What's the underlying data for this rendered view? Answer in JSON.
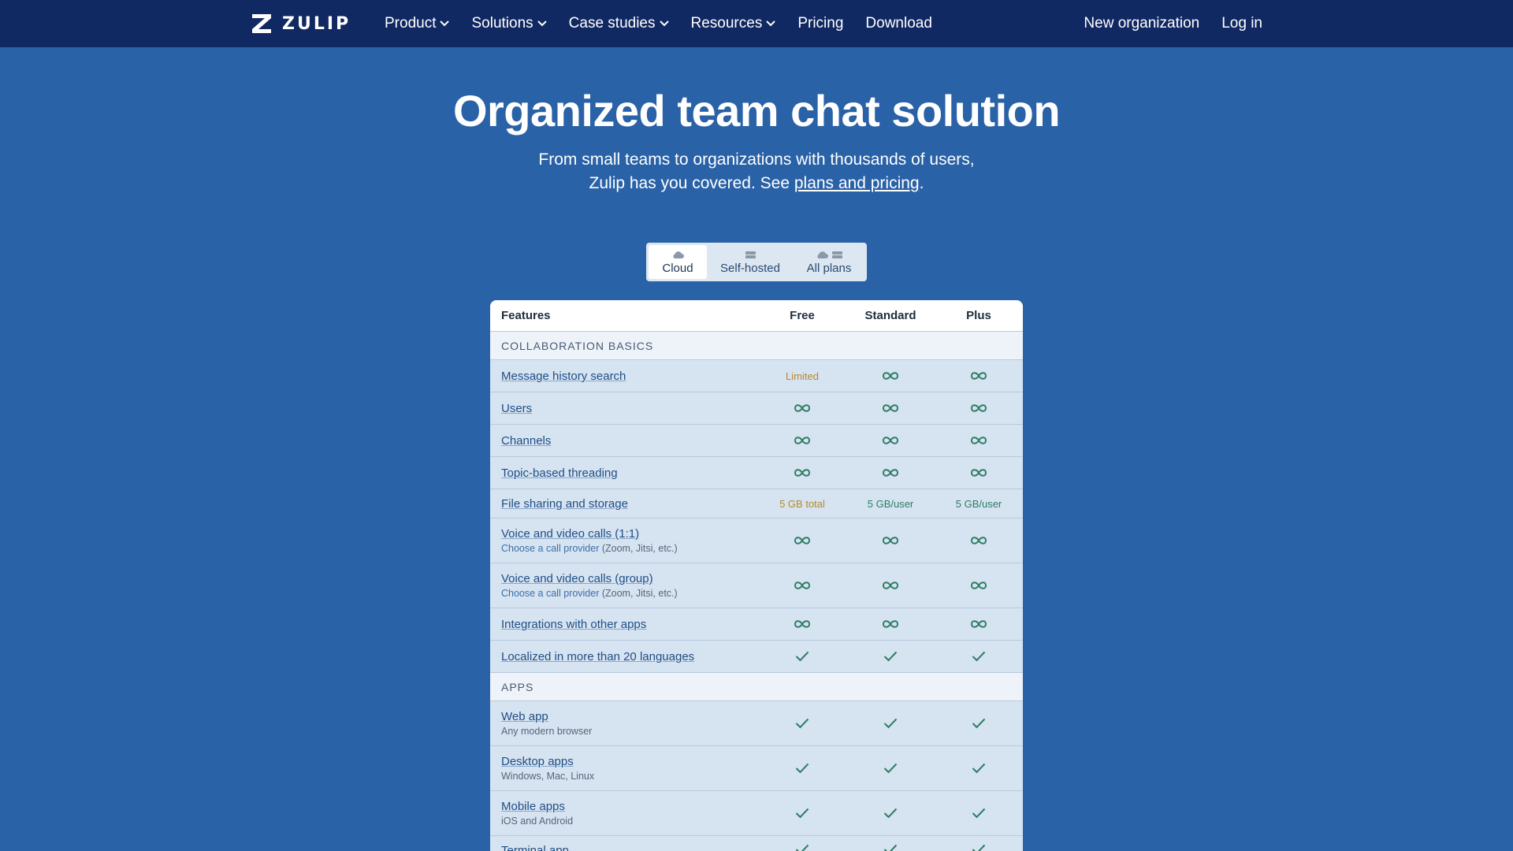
{
  "brand": {
    "name": "ZULIP"
  },
  "nav": {
    "product": "Product",
    "solutions": "Solutions",
    "case_studies": "Case studies",
    "resources": "Resources",
    "pricing": "Pricing",
    "download": "Download",
    "new_org": "New organization",
    "login": "Log in"
  },
  "hero": {
    "title": "Organized team chat solution",
    "line1": "From small teams to organizations with thousands of users,",
    "line2_prefix": "Zulip has you covered. See ",
    "line2_link": "plans and pricing",
    "line2_suffix": "."
  },
  "tabs": {
    "cloud": "Cloud",
    "self_hosted": "Self-hosted",
    "all_plans": "All plans",
    "active": "Cloud"
  },
  "table": {
    "headers": {
      "features": "Features",
      "free": "Free",
      "standard": "Standard",
      "plus": "Plus"
    },
    "section_collab": "COLLABORATION BASICS",
    "section_apps": "APPS",
    "rows": {
      "history": {
        "label": "Message history search",
        "free": "Limited"
      },
      "users": {
        "label": "Users"
      },
      "channels": {
        "label": "Channels"
      },
      "threading": {
        "label": "Topic-based threading"
      },
      "files": {
        "label": "File sharing and storage",
        "free": "5 GB total",
        "standard": "5 GB/user",
        "plus": "5 GB/user"
      },
      "calls_1on1": {
        "label": "Voice and video calls (1:1)",
        "note_link": "Choose a call provider",
        "note_text": " (Zoom, Jitsi, etc.)"
      },
      "calls_group": {
        "label": "Voice and video calls (group)",
        "note_link": "Choose a call provider",
        "note_text": " (Zoom, Jitsi, etc.)"
      },
      "integrations": {
        "label": "Integrations with other apps"
      },
      "localized": {
        "label": "Localized in more than 20 languages"
      },
      "web": {
        "label": "Web app",
        "note": "Any modern browser"
      },
      "desktop": {
        "label": "Desktop apps",
        "note": "Windows, Mac, Linux"
      },
      "mobile": {
        "label": "Mobile apps",
        "note": "iOS and Android"
      },
      "terminal": {
        "label": "Terminal app"
      }
    }
  },
  "colors": {
    "page_bg": "#2a62a7",
    "nav_bg": "#112962",
    "accent_green": "#2e7d63",
    "limited_amber": "#b8892a"
  }
}
